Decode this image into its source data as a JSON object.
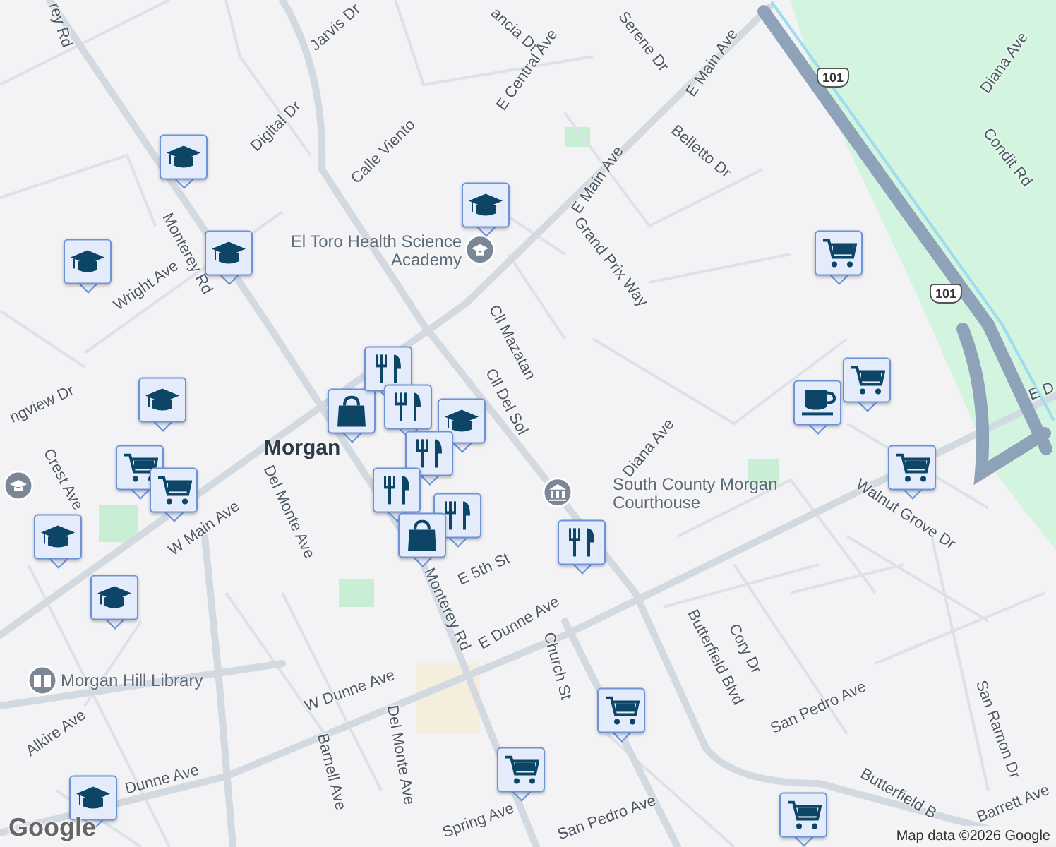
{
  "map": {
    "city_label": "Morgan",
    "street_labels": [
      "rey Rd",
      "Jarvis Dr",
      "ancia Dr",
      "E Central Ave",
      "Serene Dr",
      "E Main Ave",
      "Diana Ave",
      "Digital Dr",
      "Calle Viento",
      "Belletto Dr",
      "Condit Rd",
      "E Main Ave",
      "Monterey Rd",
      "Wright Ave",
      "Grand Prix Way",
      "Cll Mazatan",
      "Cll Del Sol",
      "E D",
      "ngview Dr",
      "Diana Ave",
      "Crest Ave",
      "W Main Ave",
      "Del Monte Ave",
      "Walnut Grove Dr",
      "Monterey Rd",
      "E 5th St",
      "E Dunne Ave",
      "Church St",
      "Cory Dr",
      "Butterfield Blvd",
      "W Dunne Ave",
      "San Pedro Ave",
      "Alkire Ave",
      "San Ramon Dr",
      "Barnell Ave",
      "Del Monte Ave",
      "Dunne Ave",
      "Spring Ave",
      "San Pedro Ave",
      "Butterfield B",
      "Barrett Ave"
    ],
    "places": [
      {
        "kind": "school",
        "name": "El Toro Health Science Academy"
      },
      {
        "kind": "government",
        "name": "South County Morgan Courthouse"
      },
      {
        "kind": "library",
        "name": "Morgan Hill Library"
      },
      {
        "kind": "school"
      }
    ],
    "highway_shields": [
      "101",
      "101"
    ],
    "markers": [
      {
        "kind": "school"
      },
      {
        "kind": "school"
      },
      {
        "kind": "school"
      },
      {
        "kind": "school"
      },
      {
        "kind": "school"
      },
      {
        "kind": "school"
      },
      {
        "kind": "school"
      },
      {
        "kind": "school"
      },
      {
        "kind": "cart"
      },
      {
        "kind": "cart"
      },
      {
        "kind": "cart"
      },
      {
        "kind": "cart"
      },
      {
        "kind": "cart"
      },
      {
        "kind": "cart"
      },
      {
        "kind": "cart"
      },
      {
        "kind": "cart"
      },
      {
        "kind": "coffee"
      },
      {
        "kind": "shop"
      },
      {
        "kind": "food"
      },
      {
        "kind": "food"
      },
      {
        "kind": "school"
      },
      {
        "kind": "food"
      },
      {
        "kind": "food"
      },
      {
        "kind": "food"
      },
      {
        "kind": "shop"
      },
      {
        "kind": "food"
      }
    ],
    "logo": "Google",
    "attribution": "Map data ©2026 Google"
  }
}
